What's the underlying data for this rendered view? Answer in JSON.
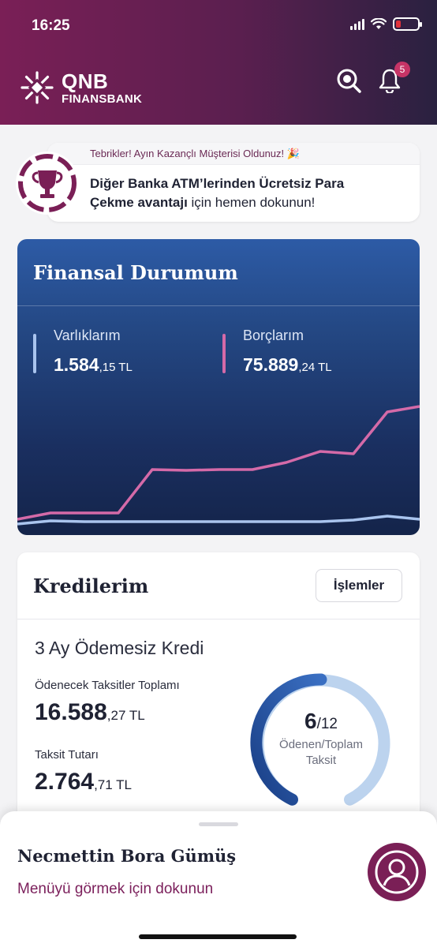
{
  "status_bar": {
    "time": "16:25"
  },
  "header": {
    "brand": "QNB",
    "brand_sub": "FINANSBANK",
    "notification_count": "5"
  },
  "promo": {
    "top_text": "Tebrikler! Ayın Kazançlı Müşterisi Oldunuz! 🎉",
    "body_bold_1": "Diğer Banka ATM’lerinden Ücretsiz Para",
    "body_bold_2": "Çekme avantajı",
    "body_rest": " için hemen dokunun!"
  },
  "financial": {
    "title": "Finansal Durumum",
    "assets": {
      "label": "Varlıklarım",
      "amount": "1.584",
      "decimals": ",15 TL",
      "color": "#a9c4ee"
    },
    "debts": {
      "label": "Borçlarım",
      "amount": "75.889",
      "decimals": ",24 TL",
      "color": "#d46aa8"
    }
  },
  "credits": {
    "title": "Kredilerim",
    "button_label": "İşlemler",
    "loan_name": "3 Ay Ödemesiz Kredi",
    "total_label": "Ödenecek Taksitler Toplamı",
    "total_amount": "16.588",
    "total_decimals": ",27 TL",
    "installment_label": "Taksit Tutarı",
    "installment_amount": "2.764",
    "installment_decimals": ",71 TL",
    "paid": "6",
    "total": "/12",
    "progress_label_1": "Ödenen/Toplam",
    "progress_label_2": "Taksit"
  },
  "sheet": {
    "user_name": "Necmettin Bora Gümüş",
    "menu_hint": "Menüyü görmek için dokunun"
  }
}
